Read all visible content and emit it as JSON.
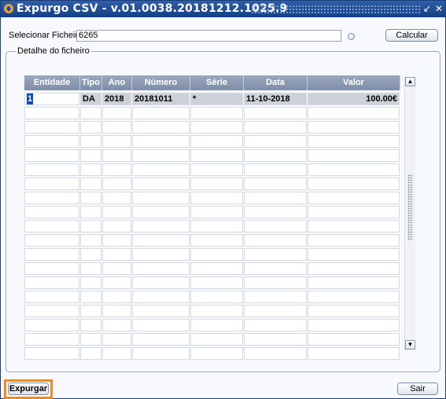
{
  "window": {
    "title": "Expurgo CSV - v.01.0038.20181212.1025.9",
    "minimize_glyph": "↙",
    "close_glyph": "✕"
  },
  "file": {
    "label": "Selecionar Ficheiro:",
    "value": "6265",
    "calc_label": "Calcular"
  },
  "details": {
    "legend": "Detalhe do ficheiro",
    "columns": [
      "Entidade",
      "Tipo",
      "Ano",
      "Número",
      "Série",
      "Data",
      "Valor"
    ],
    "rows": [
      [
        "1",
        "DA",
        "2018",
        "20181011",
        "*",
        "11-10-2018",
        "100.00€"
      ]
    ],
    "empty_rows": 18
  },
  "footer": {
    "expurgar_label": "Expurgar",
    "sair_label": "Sair"
  },
  "colors": {
    "title_bar": "#1f4a92",
    "header_bg": "#8a98b0",
    "focus_outline": "#f08a1c",
    "cursor": "#0a46c8"
  }
}
